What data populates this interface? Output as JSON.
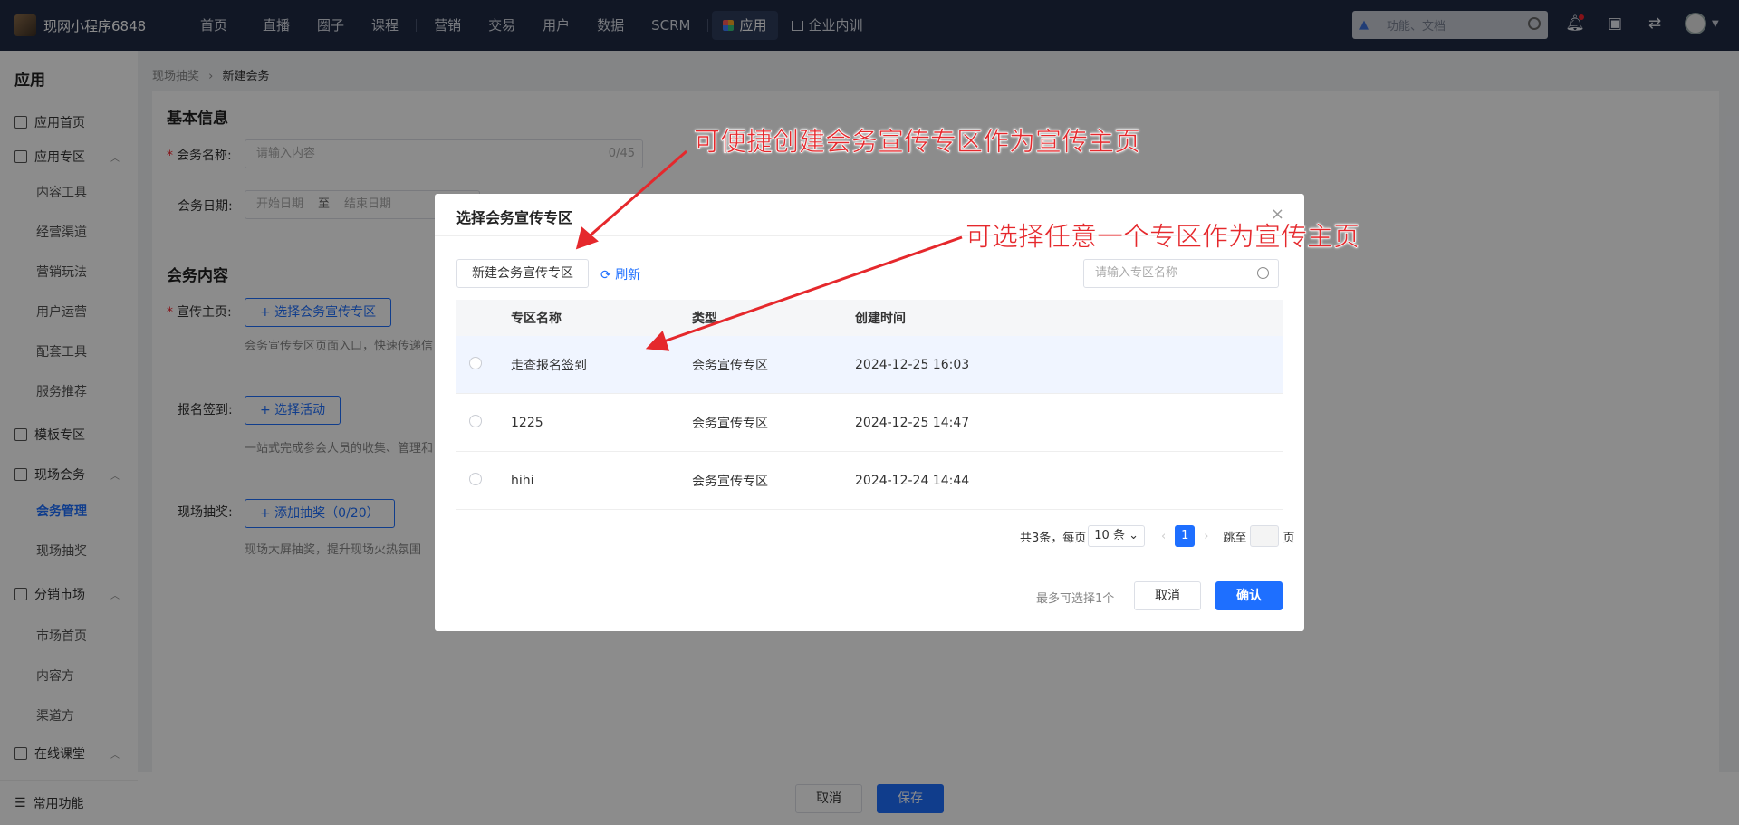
{
  "topbar": {
    "brand": "现网小程序6848",
    "nav": [
      "首页",
      "直播",
      "圈子",
      "课程",
      "营销",
      "交易",
      "用户",
      "数据",
      "SCRM"
    ],
    "nav_active": "应用",
    "nav_last": "企业内训",
    "search_placeholder": "功能、文档"
  },
  "sidebar": {
    "title": "应用",
    "items": [
      {
        "label": "应用首页"
      },
      {
        "label": "应用专区"
      },
      {
        "label": "内容工具"
      },
      {
        "label": "经营渠道"
      },
      {
        "label": "营销玩法"
      },
      {
        "label": "用户运营"
      },
      {
        "label": "配套工具"
      },
      {
        "label": "服务推荐"
      },
      {
        "label": "模板专区"
      },
      {
        "label": "现场会务"
      },
      {
        "label": "会务管理"
      },
      {
        "label": "现场抽奖"
      },
      {
        "label": "分销市场"
      },
      {
        "label": "市场首页"
      },
      {
        "label": "内容方"
      },
      {
        "label": "渠道方"
      },
      {
        "label": "在线课堂"
      }
    ],
    "bottom": "常用功能"
  },
  "breadcrumb": {
    "parent": "现场抽奖",
    "sep": "›",
    "current": "新建会务"
  },
  "form": {
    "basic_title": "基本信息",
    "name_label": "会务名称:",
    "name_placeholder": "请输入内容",
    "name_count": "0/45",
    "date_label": "会务日期:",
    "date_start": "开始日期",
    "date_to": "至",
    "date_end": "结束日期",
    "content_title": "会务内容",
    "promo_label": "宣传主页:",
    "promo_btn": "+ 选择会务宣传专区",
    "promo_desc": "会务宣传专区页面入口，快速传递信",
    "signin_label": "报名签到:",
    "signin_btn": "+ 选择活动",
    "signin_desc": "一站式完成参会人员的收集、管理和",
    "lottery_label": "现场抽奖:",
    "lottery_btn": "+ 添加抽奖（0/20）",
    "lottery_desc": "现场大屏抽奖，提升现场火热氛围"
  },
  "footer": {
    "cancel": "取消",
    "save": "保存"
  },
  "modal": {
    "title": "选择会务宣传专区",
    "close": "×",
    "new_btn": "新建会务宣传专区",
    "refresh": "刷新",
    "search_placeholder": "请输入专区名称",
    "columns": [
      "专区名称",
      "类型",
      "创建时间"
    ],
    "rows": [
      {
        "name": "走查报名签到",
        "type": "会务宣传专区",
        "time": "2024-12-25 16:03"
      },
      {
        "name": "1225",
        "type": "会务宣传专区",
        "time": "2024-12-25 14:47"
      },
      {
        "name": "hihi",
        "type": "会务宣传专区",
        "time": "2024-12-24 14:44"
      }
    ],
    "pager": {
      "total": "共3条，每页",
      "size": "10 条",
      "page": "1",
      "jump": "跳至",
      "page_unit": "页"
    },
    "hint": "最多可选择1个",
    "cancel": "取消",
    "confirm": "确认"
  },
  "annotations": {
    "a1": "可便捷创建会务宣传专区作为宣传主页",
    "a2": "可选择任意一个专区作为宣传主页"
  },
  "colors": {
    "primary": "#1e6fff",
    "topbar": "#1f2a44",
    "annotation": "#e5282c"
  }
}
